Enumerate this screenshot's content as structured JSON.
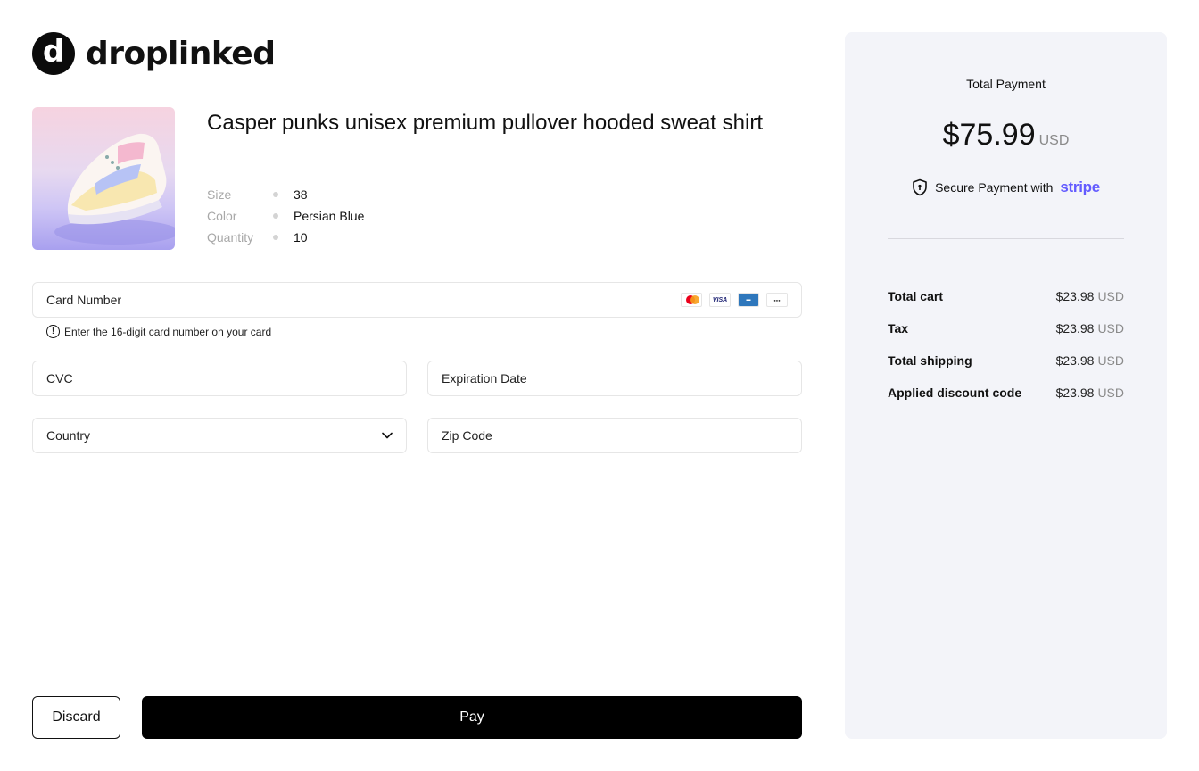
{
  "brand": {
    "name": "droplinked",
    "mark": "d"
  },
  "product": {
    "title": "Casper punks unisex premium pullover hooded sweat shirt",
    "specs": [
      {
        "label": "Size",
        "value": "38"
      },
      {
        "label": "Color",
        "value": "Persian Blue"
      },
      {
        "label": "Quantity",
        "value": "10"
      }
    ]
  },
  "form": {
    "card_number": "Card Number",
    "card_hint": "Enter the 16-digit card number on your card",
    "cvc": "CVC",
    "expiration": "Expiration Date",
    "country": "Country",
    "zip": "Zip Code",
    "card_brands": [
      "mastercard-icon",
      "visa-icon",
      "amex-icon",
      "discover-icon"
    ]
  },
  "actions": {
    "discard": "Discard",
    "pay": "Pay"
  },
  "summary": {
    "title": "Total Payment",
    "amount": "$75.99",
    "currency": "USD",
    "secure_text": "Secure Payment with",
    "provider": "stripe",
    "lines": [
      {
        "label": "Total cart",
        "amount": "$23.98",
        "currency": "USD"
      },
      {
        "label": "Tax",
        "amount": "$23.98",
        "currency": "USD"
      },
      {
        "label": "Total shipping",
        "amount": "$23.98",
        "currency": "USD"
      },
      {
        "label": "Applied discount code",
        "amount": "$23.98",
        "currency": "USD"
      }
    ]
  },
  "colors": {
    "accent": "#000000",
    "stripe": "#635bff",
    "panel": "#f3f4f9"
  }
}
